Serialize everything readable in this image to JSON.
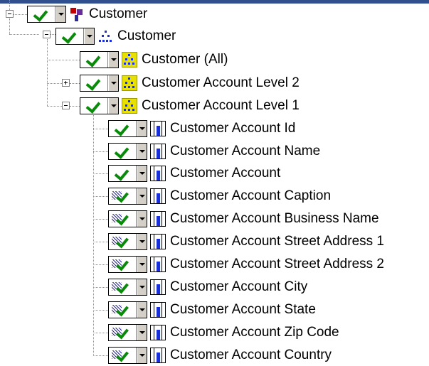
{
  "tree": {
    "dimension": {
      "label": "Customer",
      "icon": "dimension-icon",
      "state": "checked"
    },
    "hierarchy": {
      "label": "Customer",
      "icon": "hierarchy-icon",
      "state": "checked"
    },
    "levels": [
      {
        "label": "Customer (All)",
        "state": "checked",
        "expander": "none"
      },
      {
        "label": "Customer Account Level 2",
        "state": "checked",
        "expander": "plus"
      },
      {
        "label": "Customer Account Level 1",
        "state": "checked",
        "expander": "minus"
      }
    ],
    "attributes": [
      {
        "label": "Customer Account Id",
        "state": "checked"
      },
      {
        "label": "Customer Account Name",
        "state": "checked"
      },
      {
        "label": "Customer Account",
        "state": "checked"
      },
      {
        "label": "Customer Account Caption",
        "state": "partial"
      },
      {
        "label": "Customer Account Business Name",
        "state": "partial"
      },
      {
        "label": "Customer Account Street Address 1",
        "state": "partial"
      },
      {
        "label": "Customer Account Street Address 2",
        "state": "partial"
      },
      {
        "label": "Customer Account City",
        "state": "partial"
      },
      {
        "label": "Customer Account State",
        "state": "partial"
      },
      {
        "label": "Customer Account Zip Code",
        "state": "partial"
      },
      {
        "label": "Customer Account Country",
        "state": "partial"
      }
    ]
  },
  "colors": {
    "check": "#0a8a0a",
    "accent_blue": "#1b2fd6",
    "level_yellow": "#e8e000",
    "titlebar": "#2f4f8f"
  }
}
